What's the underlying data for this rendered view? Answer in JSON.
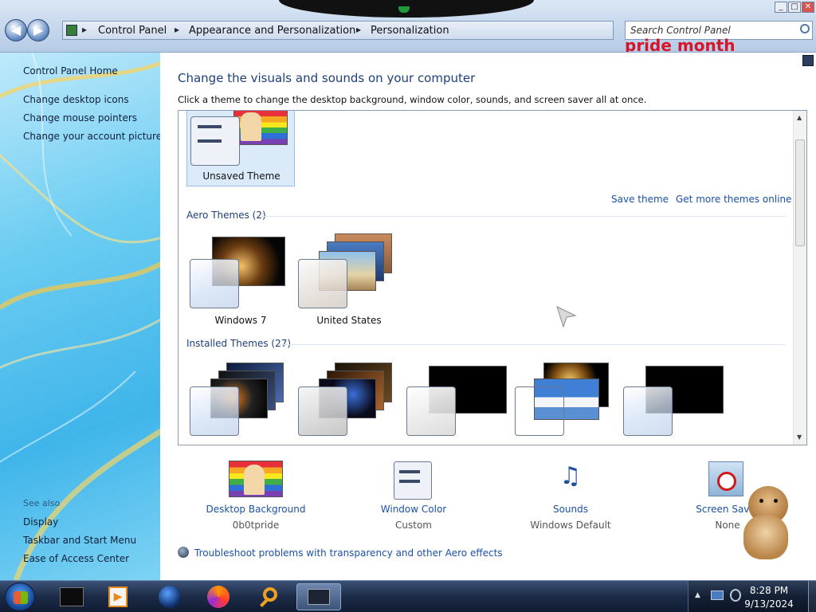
{
  "window": {
    "breadcrumb": [
      "Control Panel",
      "Appearance and Personalization",
      "Personalization"
    ],
    "search_placeholder": "Search Control Panel",
    "banner_text": "pride month",
    "controls": {
      "minimize": "_",
      "maximize": "□",
      "close": "✕"
    }
  },
  "sidebar": {
    "home": "Control Panel Home",
    "links": [
      "Change desktop icons",
      "Change mouse pointers",
      "Change your account picture"
    ],
    "see_also_label": "See also",
    "see_also": [
      "Display",
      "Taskbar and Start Menu",
      "Ease of Access Center"
    ]
  },
  "main": {
    "title": "Change the visuals and sounds on your computer",
    "subtitle": "Click a theme to change the desktop background, window color, sounds, and screen saver all at once.",
    "my_theme": {
      "name": "Unsaved Theme"
    },
    "actions": {
      "save": "Save theme",
      "more": "Get more themes online"
    },
    "aero_group": {
      "header": "Aero Themes (2)",
      "themes": [
        "Windows 7",
        "United States"
      ]
    },
    "installed_group": {
      "header": "Installed Themes (27)"
    },
    "settings": [
      {
        "label": "Desktop Background",
        "value": "0b0tpride"
      },
      {
        "label": "Window Color",
        "value": "Custom"
      },
      {
        "label": "Sounds",
        "value": "Windows Default"
      },
      {
        "label": "Screen Saver",
        "value": "None"
      }
    ],
    "troubleshoot": "Troubleshoot problems with transparency and other Aero effects"
  },
  "taskbar": {
    "pinned_icons": [
      "cmd-icon",
      "media-player-icon",
      "globe-browser-icon",
      "firefox-icon",
      "search-magnifier-icon",
      "personalization-window-icon"
    ],
    "clock_time": "8:28 PM",
    "clock_date": "9/13/2024"
  },
  "colors": {
    "link": "#1a51a6",
    "title": "#1e3f7a",
    "sidebar": "#3fb5ea",
    "taskbar": "#1c2b47"
  }
}
